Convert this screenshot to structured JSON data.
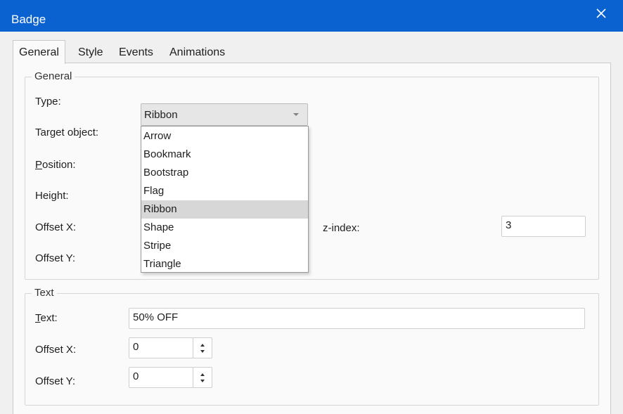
{
  "window": {
    "title": "Badge",
    "close_icon": "close-icon"
  },
  "tabs": [
    {
      "label": "General",
      "active": true
    },
    {
      "label": "Style",
      "active": false
    },
    {
      "label": "Events",
      "active": false
    },
    {
      "label": "Animations",
      "active": false
    }
  ],
  "general_group": {
    "title": "General",
    "type_label": "Type:",
    "type_value": "Ribbon",
    "type_options": [
      "Arrow",
      "Bookmark",
      "Bootstrap",
      "Flag",
      "Ribbon",
      "Shape",
      "Stripe",
      "Triangle"
    ],
    "target_label": "Target object:",
    "position_label_first": "P",
    "position_label_rest": "osition:",
    "height_label": "Height:",
    "offset_x_label": "Offset X:",
    "offset_y_label": "Offset Y:",
    "zindex_label": "z-index:",
    "zindex_value": "3"
  },
  "text_group": {
    "title": "Text",
    "text_label_first": "T",
    "text_label_rest": "ext:",
    "text_value": "50% OFF",
    "offset_x_label": "Offset X:",
    "offset_x_value": "0",
    "offset_y_label": "Offset Y:",
    "offset_y_value": "0"
  },
  "colors": {
    "titlebar": "#0a62d0",
    "dialog_bg": "#f0f0f0",
    "panel_bg": "#fafafa",
    "selected_option": "#d7d7d7"
  }
}
